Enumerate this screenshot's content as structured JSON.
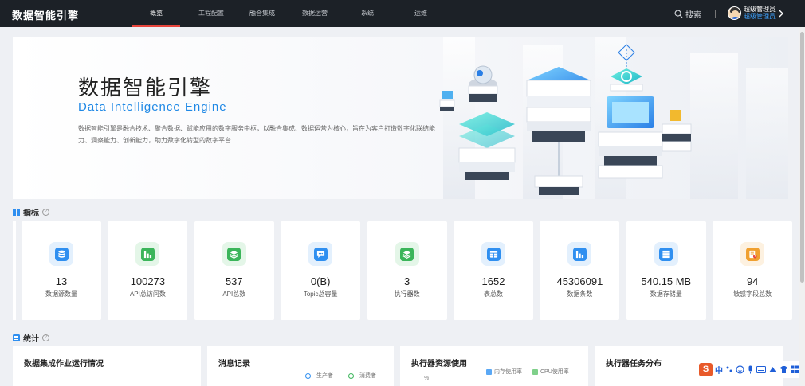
{
  "app": {
    "title": "数据智能引擎"
  },
  "nav": [
    {
      "label": "概览",
      "active": true
    },
    {
      "label": "工程配置",
      "active": false
    },
    {
      "label": "融合集成",
      "active": false
    },
    {
      "label": "数据运营",
      "active": false
    },
    {
      "label": "系统",
      "active": false
    },
    {
      "label": "运维",
      "active": false
    }
  ],
  "header": {
    "search_label": "搜索",
    "user_name": "超级管理员",
    "user_role": "超级管理员"
  },
  "banner": {
    "title": "数据智能引擎",
    "subtitle": "Data Intelligence Engine",
    "description": "数据智能引擎是融合技术、聚合数据、赋能应用的数字服务中枢，以融合集成、数据运营为核心，旨在为客户打造数字化联结能力、洞察能力、创新能力，助力数字化转型的数字平台"
  },
  "metrics": {
    "title": "指标",
    "items": [
      {
        "value": "13",
        "label": "数据源数量",
        "icon": "database-icon",
        "color": "#2f8ff0",
        "bg": "#e3f0fd"
      },
      {
        "value": "100273",
        "label": "API总访问数",
        "icon": "bar-chart-icon",
        "color": "#3bb55a",
        "bg": "#e4f6e8"
      },
      {
        "value": "537",
        "label": "API总数",
        "icon": "layers-icon",
        "color": "#3bb55a",
        "bg": "#e4f6e8"
      },
      {
        "value": "0(B)",
        "label": "Topic总容量",
        "icon": "message-icon",
        "color": "#2f8ff0",
        "bg": "#e3f0fd"
      },
      {
        "value": "3",
        "label": "执行器数",
        "icon": "layers-icon",
        "color": "#3bb55a",
        "bg": "#e4f6e8"
      },
      {
        "value": "1652",
        "label": "表总数",
        "icon": "table-icon",
        "color": "#2f8ff0",
        "bg": "#e3f0fd"
      },
      {
        "value": "45306091",
        "label": "数据条数",
        "icon": "bar-chart-icon",
        "color": "#2f8ff0",
        "bg": "#e3f0fd"
      },
      {
        "value": "540.15 MB",
        "label": "数据存储量",
        "icon": "server-icon",
        "color": "#2f8ff0",
        "bg": "#e3f0fd"
      },
      {
        "value": "94",
        "label": "敏感字段总数",
        "icon": "document-alert-icon",
        "color": "#f0a030",
        "bg": "#fdf1e0"
      }
    ]
  },
  "stats": {
    "title": "统计",
    "panels": [
      {
        "title": "数据集成作业运行情况"
      },
      {
        "title": "消息记录",
        "legend": [
          "生产者",
          "消费者"
        ],
        "legend_colors": [
          "#2f8ff0",
          "#3bb55a"
        ]
      },
      {
        "title": "执行器资源使用",
        "legend": [
          "内存使用率",
          "CPU使用率"
        ],
        "legend_colors": [
          "#5aa8f5",
          "#7fd08a"
        ],
        "axis_unit": "%"
      },
      {
        "title": "执行器任务分布"
      }
    ]
  },
  "ime": {
    "label": "中"
  }
}
